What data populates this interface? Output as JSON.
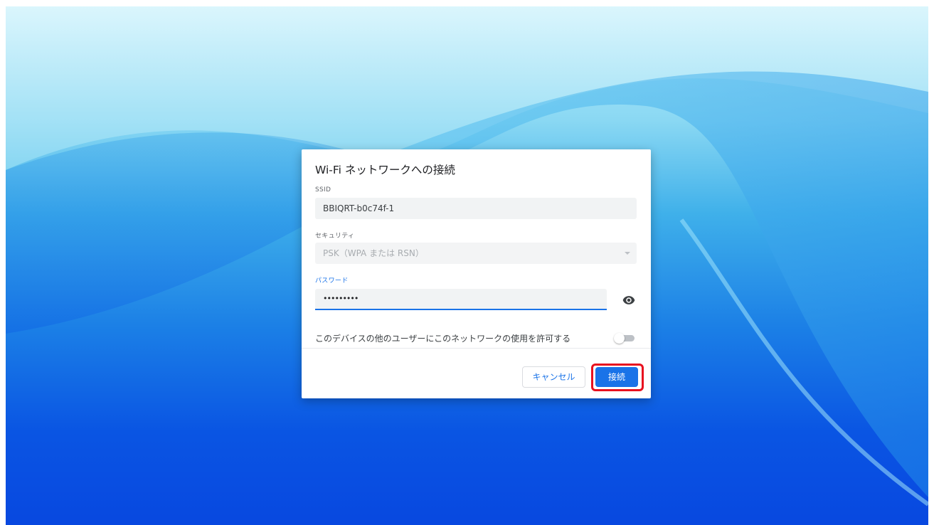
{
  "dialog": {
    "title": "Wi-Fi ネットワークへの接続",
    "ssid": {
      "label": "SSID",
      "value": "BBIQRT-b0c74f-1"
    },
    "security": {
      "label": "セキュリティ",
      "value": "PSK（WPA または RSN）"
    },
    "password": {
      "label": "パスワード",
      "value": "•••••••••",
      "icon": "eye-icon"
    },
    "share": {
      "label": "このデバイスの他のユーザーにこのネットワークの使用を許可する",
      "enabled": false
    },
    "buttons": {
      "cancel": "キャンセル",
      "connect": "接続"
    }
  },
  "colors": {
    "accent": "#1a73e8",
    "highlight": "#e8101f"
  }
}
